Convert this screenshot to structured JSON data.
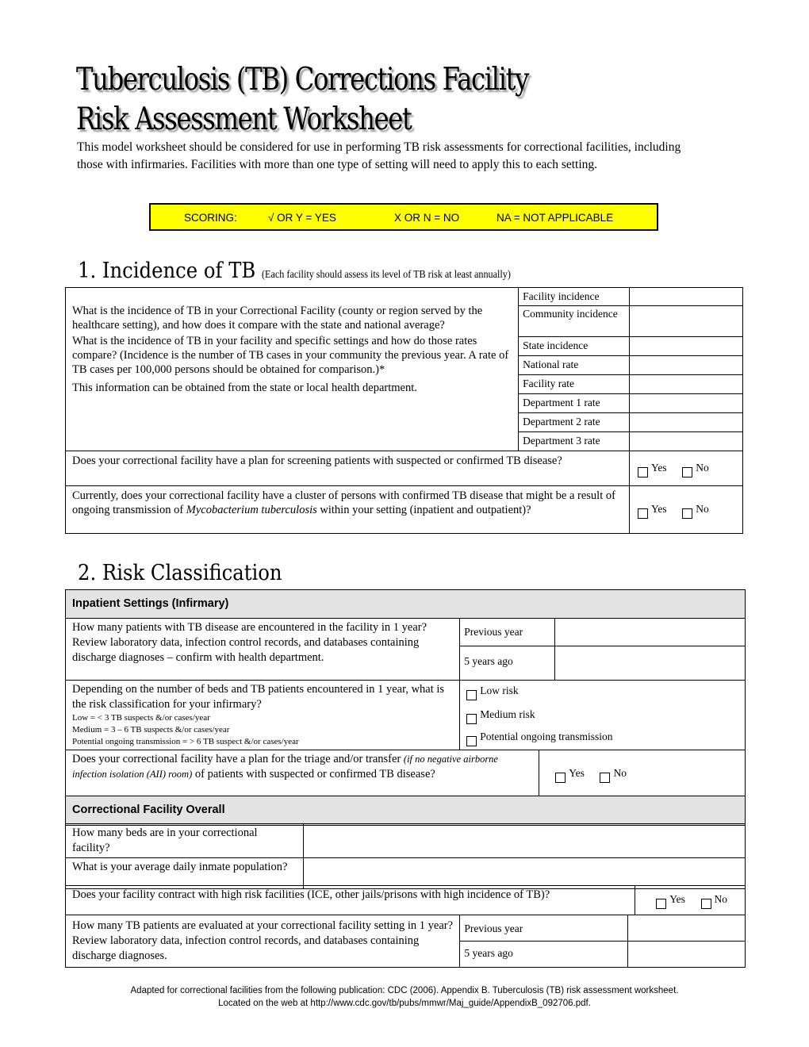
{
  "title_line1": "Tuberculosis (TB) Corrections Facility",
  "title_line2": "Risk Assessment Worksheet",
  "intro": "This model worksheet should be considered for use in performing TB risk assessments for correctional facilities, including those with infirmaries. Facilities with more than one type of setting will need to apply this to each setting.",
  "scoring": {
    "label": "SCORING:",
    "yes": "√ OR Y = YES",
    "no": "X OR N = NO",
    "na": "NA = NOT APPLICABLE",
    "background_color": "#ffff00"
  },
  "section1": {
    "heading": "1.  Incidence of TB",
    "subheading": "(Each facility should assess its level of TB risk at least annually)",
    "q1": "What is the incidence of TB in your Correctional Facility (county or region served by the healthcare setting), and how does it compare with the state and national average?",
    "q2": "What is the incidence of TB in your facility and specific settings and how do those rates compare? (Incidence is the number of TB cases in your community the previous year. A rate of TB cases per 100,000 persons should be obtained for comparison.)*",
    "q3": "This information can be obtained from the state or local health department.",
    "rate_labels": [
      "Facility incidence",
      "Community incidence",
      "State incidence",
      "National rate",
      "Facility rate",
      "Department 1 rate",
      "Department 2 rate",
      "Department 3 rate"
    ],
    "rate_values": [
      "",
      "",
      "",
      "",
      "",
      "",
      "",
      ""
    ],
    "screening_question": "Does your correctional facility have a plan for screening patients with suspected or confirmed TB disease?",
    "cluster_question_pre": "Currently, does your correctional facility have a cluster of persons with confirmed TB disease that might be a result of ongoing transmission of ",
    "cluster_question_italic": "Mycobacterium tuberculosis",
    "cluster_question_post": " within your setting (inpatient and outpatient)?",
    "yes_label": "Yes",
    "no_label": "No"
  },
  "section2": {
    "heading": "2.  Risk Classification",
    "inpatient_header": "Inpatient Settings (Infirmary)",
    "encounter_q1": "How many patients with TB disease are encountered in the facility in 1 year?",
    "encounter_q2": "Review laboratory data, infection control records, and databases containing discharge diagnoses – confirm with health department.",
    "previous_year": "Previous year",
    "five_years_ago": "5 years ago",
    "risk_q": "Depending on the number of beds and TB patients encountered in 1 year, what is the risk classification for your infirmary?",
    "risk_low_def": "Low =  < 3 TB suspects &/or cases/year",
    "risk_medium_def": "Medium = 3 – 6 TB suspects &/or cases/year",
    "risk_potential_def": "Potential ongoing transmission = > 6 TB suspect &/or cases/year",
    "risk_options": [
      "Low risk",
      "Medium risk",
      "Potential ongoing transmission"
    ],
    "triage_q_pre": "Does your correctional facility have a plan for the triage and/or transfer ",
    "triage_q_italic": "(if no negative airborne infection isolation (AII) room)",
    "triage_q_post": " of patients with suspected or confirmed TB disease?",
    "overall_header": "Correctional Facility Overall",
    "beds_q": "How many beds are in your correctional facility?",
    "population_q": "What is your average daily inmate population?",
    "contract_q": "Does your facility contract with high risk facilities (ICE, other jails/prisons with high incidence of TB)?",
    "evaluated_q": "How many TB patients are evaluated at your correctional facility setting in 1 year? Review laboratory data, infection control records, and databases containing discharge diagnoses.",
    "yes_label": "Yes",
    "no_label": "No"
  },
  "footer": {
    "line1": "Adapted for correctional facilities from the following publication: CDC (2006). Appendix B. Tuberculosis (TB) risk assessment worksheet.",
    "line2": "Located on the web at http://www.cdc.gov/tb/pubs/mmwr/Maj_guide/AppendixB_092706.pdf."
  }
}
